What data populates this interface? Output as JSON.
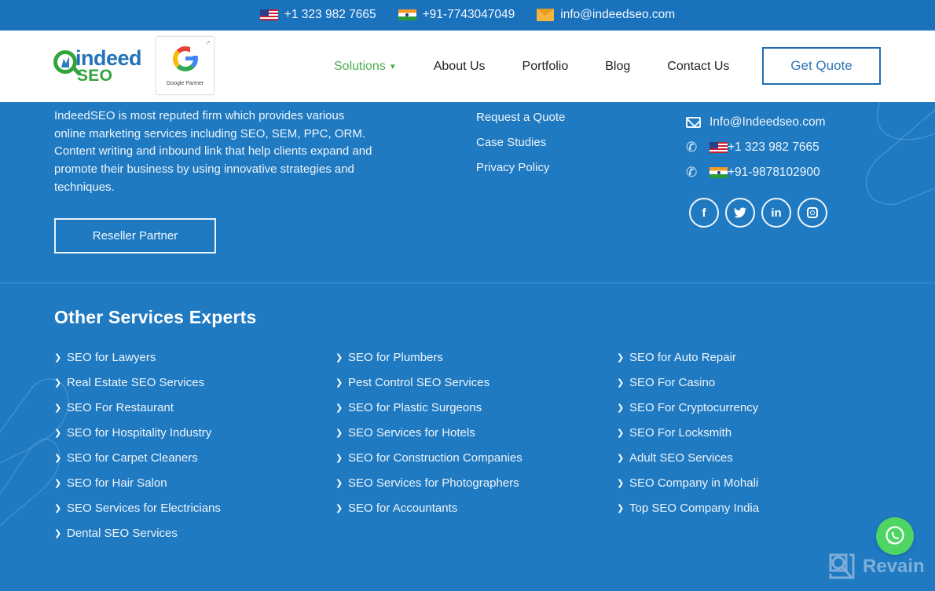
{
  "topbar": {
    "us_phone": "+1 323 982 7665",
    "in_phone": "+91-7743047049",
    "email": "info@indeedseo.com"
  },
  "header": {
    "logo_word1": "indeed",
    "logo_word2": "SEO",
    "google_partner_label": "Google Partner",
    "nav": [
      {
        "label": "Solutions",
        "active": true,
        "has_dropdown": true
      },
      {
        "label": "About Us"
      },
      {
        "label": "Portfolio"
      },
      {
        "label": "Blog"
      },
      {
        "label": "Contact Us"
      }
    ],
    "cta_label": "Get Quote"
  },
  "footer": {
    "about_text": "IndeedSEO is most reputed firm which provides various online marketing services including SEO, SEM, PPC, ORM. Content writing and inbound link that help clients expand and promote their business by using innovative strategies and techniques.",
    "reseller_label": "Reseller Partner",
    "links": [
      "Request a Quote",
      "Case Studies",
      "Privacy Policy"
    ],
    "contact": {
      "email": "Info@Indeedseo.com",
      "us_phone": "+1 323 982 7665",
      "in_phone": "+91-9878102900"
    },
    "socials": [
      {
        "name": "facebook",
        "glyph": "f"
      },
      {
        "name": "twitter",
        "glyph": "🐦"
      },
      {
        "name": "linkedin",
        "glyph": "in"
      },
      {
        "name": "instagram",
        "glyph": ""
      }
    ]
  },
  "services": {
    "title": "Other Services Experts",
    "columns": [
      [
        "SEO for Lawyers",
        "Real Estate SEO Services",
        "SEO For Restaurant",
        "SEO for Hospitality Industry",
        "SEO for Carpet Cleaners",
        "SEO for Hair Salon",
        "SEO Services for Electricians",
        "Dental SEO Services"
      ],
      [
        "SEO for Plumbers",
        "Pest Control SEO Services",
        "SEO for Plastic Surgeons",
        "SEO Services for Hotels",
        "SEO for Construction Companies",
        "SEO Services for Photographers",
        "SEO for Accountants"
      ],
      [
        "SEO for Auto Repair",
        "SEO For Casino",
        "SEO For Cryptocurrency",
        "SEO For Locksmith",
        "Adult SEO Services",
        "SEO Company in Mohali",
        "Top SEO Company India"
      ]
    ]
  },
  "widgets": {
    "revain_label": "Revain"
  },
  "colors": {
    "footer_bg": "#1f7ac2",
    "topbar_bg": "#1a72bd",
    "nav_active": "#4caf50",
    "cta_border": "#1f6fb0",
    "whatsapp": "#4ed564"
  }
}
